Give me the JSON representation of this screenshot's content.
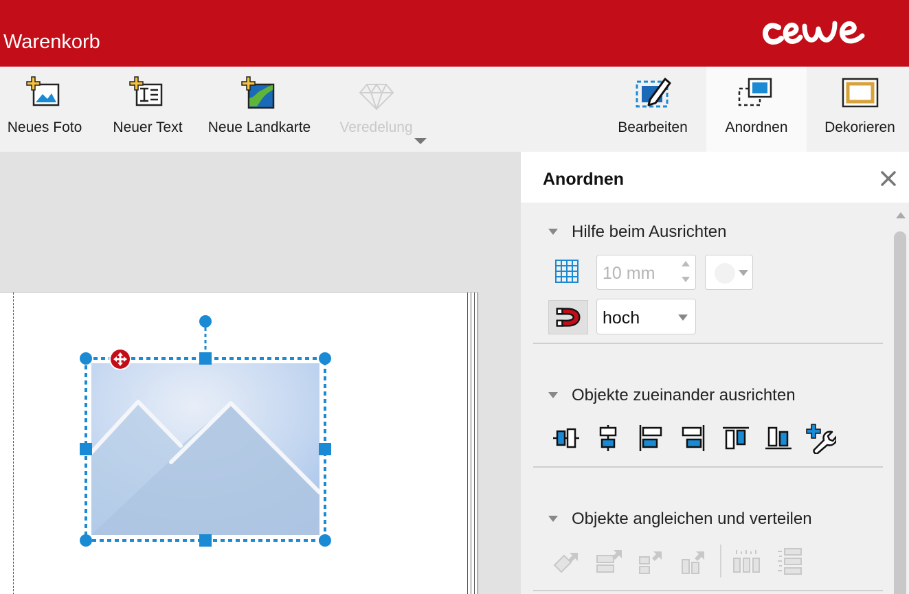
{
  "header": {
    "title": "Warenkorb",
    "logo_text": "cewe"
  },
  "toolbar": {
    "left_tools": [
      {
        "label": "Neues Foto",
        "icon": "add-photo-icon"
      },
      {
        "label": "Neuer Text",
        "icon": "add-text-icon"
      },
      {
        "label": "Neue Landkarte",
        "icon": "add-map-icon"
      },
      {
        "label": "Veredelung",
        "icon": "diamond-icon",
        "disabled": true
      }
    ],
    "right_tools": [
      {
        "label": "Bearbeiten",
        "icon": "edit-icon"
      },
      {
        "label": "Anordnen",
        "icon": "arrange-icon",
        "active": true
      },
      {
        "label": "Dekorieren",
        "icon": "decorate-icon"
      }
    ]
  },
  "panel": {
    "title": "Anordnen",
    "sections": [
      {
        "title": "Hilfe beim Ausrichten"
      },
      {
        "title": "Objekte zueinander ausrichten"
      },
      {
        "title": "Objekte angleichen und verteilen"
      }
    ],
    "grid_size": {
      "value": "10 mm"
    },
    "snap": {
      "value": "hoch"
    },
    "align_buttons": [
      "align-horizontal-center-icon",
      "align-vertical-center-icon",
      "align-left-icon",
      "align-right-icon",
      "align-top-icon",
      "align-bottom-icon",
      "align-tools-icon"
    ],
    "distribute_buttons": [
      "match-size-icon",
      "match-width-icon",
      "match-height-icon",
      "match-height-alt-icon",
      "distribute-horizontal-icon",
      "distribute-vertical-icon"
    ]
  },
  "colors": {
    "brand": "#c30d18",
    "accent": "#1a8ad4",
    "selection": "#1a8ad4"
  }
}
